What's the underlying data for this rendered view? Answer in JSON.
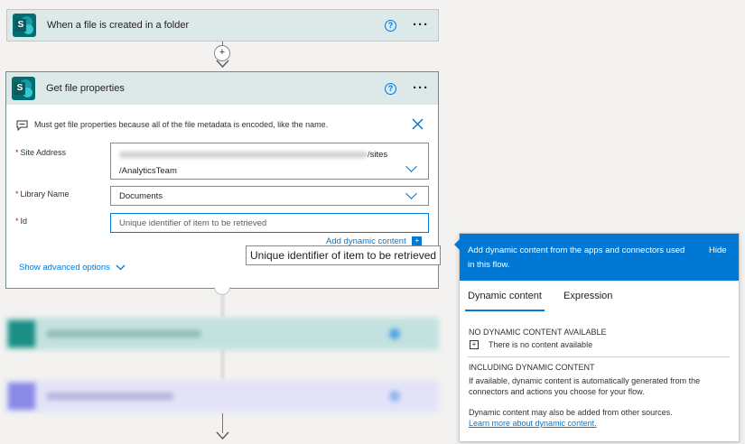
{
  "step1": {
    "title": "When a file is created in a folder"
  },
  "step2": {
    "title": "Get file properties",
    "info_message": "Must get file properties because all of the file metadata is encoded, like the name.",
    "site_address": {
      "label": "Site Address",
      "value_line1_suffix": "/sites",
      "value_line2": "/AnalyticsTeam"
    },
    "library_name": {
      "label": "Library Name",
      "value": "Documents"
    },
    "id": {
      "label": "Id",
      "placeholder": "Unique identifier of item to be retrieved"
    },
    "add_dynamic_content": "Add dynamic content",
    "show_advanced": "Show advanced options"
  },
  "tooltip": "Unique identifier of item to be retrieved",
  "dynamic_panel": {
    "header_text": "Add dynamic content from the apps and connectors used in this flow.",
    "hide": "Hide",
    "tabs": [
      "Dynamic content",
      "Expression"
    ],
    "no_content_title": "NO DYNAMIC CONTENT AVAILABLE",
    "no_content_text": "There is no content available",
    "including_title": "INCLUDING DYNAMIC CONTENT",
    "including_text": "If available, dynamic content is automatically generated from the connectors and actions you choose for your flow.",
    "other_sources": "Dynamic content may also be added from other sources.",
    "learn_more": "Learn more about dynamic content."
  },
  "colors": {
    "accent": "#0078d4",
    "sharepoint": "#036c70",
    "header_bg": "#dde8e8"
  }
}
